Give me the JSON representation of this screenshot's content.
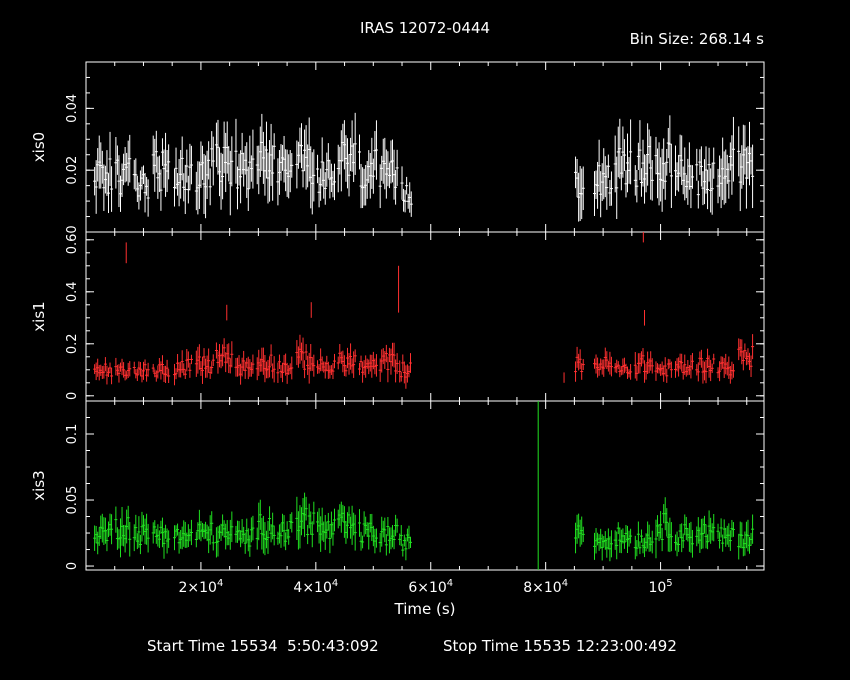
{
  "title": "IRAS 12072-0444",
  "bin_size_text": "Bin Size: 268.14 s",
  "xlabel": "Time (s)",
  "footer": {
    "start": "Start Time 15534  5:50:43:092",
    "stop": "Stop Time 15535 12:23:00:492"
  },
  "x_ticks": [
    {
      "value": 20000,
      "label": "2×10",
      "exp": "4"
    },
    {
      "value": 40000,
      "label": "4×10",
      "exp": "4"
    },
    {
      "value": 60000,
      "label": "6×10",
      "exp": "4"
    },
    {
      "value": 80000,
      "label": "8×10",
      "exp": "4"
    },
    {
      "value": 100000,
      "label": "10",
      "exp": "5"
    }
  ],
  "chart_data": [
    {
      "type": "line",
      "name": "xis0",
      "ylabel": "xis0",
      "color": "#ffffff",
      "ylim": [
        0,
        0.055
      ],
      "yticks": [
        {
          "v": 0.02,
          "l": "0.02"
        },
        {
          "v": 0.04,
          "l": "0.04"
        }
      ],
      "segments": [
        {
          "start": 1500,
          "end": 4600,
          "mean": 0.018,
          "amp": 0.006
        },
        {
          "start": 5200,
          "end": 7800,
          "mean": 0.018,
          "amp": 0.006
        },
        {
          "start": 8400,
          "end": 11000,
          "mean": 0.015,
          "amp": 0.005
        },
        {
          "start": 11700,
          "end": 14600,
          "mean": 0.02,
          "amp": 0.007
        },
        {
          "start": 15400,
          "end": 18600,
          "mean": 0.018,
          "amp": 0.006
        },
        {
          "start": 19200,
          "end": 22200,
          "mean": 0.02,
          "amp": 0.007
        },
        {
          "start": 22700,
          "end": 25500,
          "mean": 0.022,
          "amp": 0.007
        },
        {
          "start": 26100,
          "end": 29200,
          "mean": 0.02,
          "amp": 0.007
        },
        {
          "start": 29800,
          "end": 33000,
          "mean": 0.022,
          "amp": 0.007
        },
        {
          "start": 33400,
          "end": 36000,
          "mean": 0.02,
          "amp": 0.006
        },
        {
          "start": 36700,
          "end": 39800,
          "mean": 0.022,
          "amp": 0.007
        },
        {
          "start": 40300,
          "end": 43400,
          "mean": 0.018,
          "amp": 0.006
        },
        {
          "start": 43900,
          "end": 47000,
          "mean": 0.023,
          "amp": 0.007
        },
        {
          "start": 47600,
          "end": 50600,
          "mean": 0.02,
          "amp": 0.007
        },
        {
          "start": 51200,
          "end": 54300,
          "mean": 0.017,
          "amp": 0.006
        },
        {
          "start": 55000,
          "end": 56700,
          "mean": 0.012,
          "amp": 0.004
        },
        {
          "start": 85200,
          "end": 86800,
          "mean": 0.017,
          "amp": 0.006
        },
        {
          "start": 88500,
          "end": 91500,
          "mean": 0.018,
          "amp": 0.006
        },
        {
          "start": 92100,
          "end": 95000,
          "mean": 0.02,
          "amp": 0.007
        },
        {
          "start": 95600,
          "end": 98600,
          "mean": 0.021,
          "amp": 0.007
        },
        {
          "start": 99200,
          "end": 102000,
          "mean": 0.022,
          "amp": 0.007
        },
        {
          "start": 102600,
          "end": 105700,
          "mean": 0.02,
          "amp": 0.006
        },
        {
          "start": 106300,
          "end": 109400,
          "mean": 0.018,
          "amp": 0.006
        },
        {
          "start": 110000,
          "end": 112900,
          "mean": 0.021,
          "amp": 0.007
        },
        {
          "start": 113600,
          "end": 116200,
          "mean": 0.02,
          "amp": 0.007
        }
      ]
    },
    {
      "type": "line",
      "name": "xis1",
      "ylabel": "xis1",
      "color": "#ff3030",
      "ylim": [
        -0.02,
        0.63
      ],
      "yticks": [
        {
          "v": 0,
          "l": "0"
        },
        {
          "v": 0.2,
          "l": "0.2"
        },
        {
          "v": 0.4,
          "l": "0.4"
        },
        {
          "v": 0.6,
          "l": "0.60"
        }
      ],
      "segments": [
        {
          "start": 1500,
          "end": 4600,
          "mean": 0.1,
          "amp": 0.025
        },
        {
          "start": 5200,
          "end": 7800,
          "mean": 0.09,
          "amp": 0.025
        },
        {
          "start": 8400,
          "end": 11000,
          "mean": 0.1,
          "amp": 0.025
        },
        {
          "start": 11700,
          "end": 14600,
          "mean": 0.1,
          "amp": 0.025
        },
        {
          "start": 15400,
          "end": 18600,
          "mean": 0.11,
          "amp": 0.03
        },
        {
          "start": 19200,
          "end": 22200,
          "mean": 0.12,
          "amp": 0.035
        },
        {
          "start": 22700,
          "end": 25500,
          "mean": 0.15,
          "amp": 0.04
        },
        {
          "start": 26100,
          "end": 29200,
          "mean": 0.11,
          "amp": 0.03
        },
        {
          "start": 29800,
          "end": 33000,
          "mean": 0.13,
          "amp": 0.035
        },
        {
          "start": 33400,
          "end": 36000,
          "mean": 0.11,
          "amp": 0.03
        },
        {
          "start": 36700,
          "end": 39800,
          "mean": 0.14,
          "amp": 0.04
        },
        {
          "start": 40300,
          "end": 43400,
          "mean": 0.11,
          "amp": 0.03
        },
        {
          "start": 43900,
          "end": 47000,
          "mean": 0.13,
          "amp": 0.035
        },
        {
          "start": 47600,
          "end": 50600,
          "mean": 0.11,
          "amp": 0.03
        },
        {
          "start": 51200,
          "end": 54300,
          "mean": 0.13,
          "amp": 0.035
        },
        {
          "start": 54600,
          "end": 56700,
          "mean": 0.1,
          "amp": 0.03
        },
        {
          "start": 85200,
          "end": 86800,
          "mean": 0.12,
          "amp": 0.03
        },
        {
          "start": 88500,
          "end": 91500,
          "mean": 0.12,
          "amp": 0.03
        },
        {
          "start": 92100,
          "end": 95000,
          "mean": 0.1,
          "amp": 0.025
        },
        {
          "start": 95600,
          "end": 98600,
          "mean": 0.12,
          "amp": 0.035
        },
        {
          "start": 99200,
          "end": 102000,
          "mean": 0.1,
          "amp": 0.025
        },
        {
          "start": 102600,
          "end": 105700,
          "mean": 0.11,
          "amp": 0.03
        },
        {
          "start": 106300,
          "end": 109400,
          "mean": 0.12,
          "amp": 0.03
        },
        {
          "start": 110000,
          "end": 112900,
          "mean": 0.11,
          "amp": 0.03
        },
        {
          "start": 113600,
          "end": 116200,
          "mean": 0.15,
          "amp": 0.04
        }
      ],
      "outliers": [
        {
          "x": 7000,
          "y": 0.55,
          "err": 0.04
        },
        {
          "x": 54400,
          "y": 0.41,
          "err": 0.09
        },
        {
          "x": 83200,
          "y": 0.07,
          "err": 0.02
        },
        {
          "x": 97000,
          "y": 0.62,
          "err": 0.03
        },
        {
          "x": 97200,
          "y": 0.3,
          "err": 0.03
        },
        {
          "x": 24500,
          "y": 0.32,
          "err": 0.03
        },
        {
          "x": 39200,
          "y": 0.33,
          "err": 0.03
        }
      ]
    },
    {
      "type": "line",
      "name": "xis3",
      "ylabel": "xis3",
      "color": "#20e020",
      "ylim": [
        -0.003,
        0.125
      ],
      "yticks": [
        {
          "v": 0,
          "l": "0"
        },
        {
          "v": 0.05,
          "l": "0.05"
        },
        {
          "v": 0.1,
          "l": "0.1"
        }
      ],
      "segments": [
        {
          "start": 1500,
          "end": 4600,
          "mean": 0.025,
          "amp": 0.008
        },
        {
          "start": 5200,
          "end": 7800,
          "mean": 0.03,
          "amp": 0.01
        },
        {
          "start": 8400,
          "end": 11000,
          "mean": 0.024,
          "amp": 0.008
        },
        {
          "start": 11700,
          "end": 14600,
          "mean": 0.025,
          "amp": 0.008
        },
        {
          "start": 15400,
          "end": 18600,
          "mean": 0.022,
          "amp": 0.007
        },
        {
          "start": 19200,
          "end": 22200,
          "mean": 0.025,
          "amp": 0.008
        },
        {
          "start": 22700,
          "end": 25500,
          "mean": 0.024,
          "amp": 0.008
        },
        {
          "start": 26100,
          "end": 29200,
          "mean": 0.022,
          "amp": 0.007
        },
        {
          "start": 29800,
          "end": 33000,
          "mean": 0.03,
          "amp": 0.01
        },
        {
          "start": 33400,
          "end": 36000,
          "mean": 0.026,
          "amp": 0.008
        },
        {
          "start": 36700,
          "end": 39800,
          "mean": 0.035,
          "amp": 0.012
        },
        {
          "start": 40300,
          "end": 43400,
          "mean": 0.027,
          "amp": 0.009
        },
        {
          "start": 43900,
          "end": 47000,
          "mean": 0.03,
          "amp": 0.01
        },
        {
          "start": 47600,
          "end": 50600,
          "mean": 0.025,
          "amp": 0.008
        },
        {
          "start": 51200,
          "end": 54300,
          "mean": 0.023,
          "amp": 0.008
        },
        {
          "start": 54600,
          "end": 56700,
          "mean": 0.018,
          "amp": 0.006
        },
        {
          "start": 85200,
          "end": 86800,
          "mean": 0.028,
          "amp": 0.009
        },
        {
          "start": 88500,
          "end": 91500,
          "mean": 0.02,
          "amp": 0.007
        },
        {
          "start": 92100,
          "end": 95000,
          "mean": 0.022,
          "amp": 0.007
        },
        {
          "start": 95600,
          "end": 98600,
          "mean": 0.02,
          "amp": 0.007
        },
        {
          "start": 99200,
          "end": 102000,
          "mean": 0.03,
          "amp": 0.01
        },
        {
          "start": 102600,
          "end": 105700,
          "mean": 0.024,
          "amp": 0.008
        },
        {
          "start": 106300,
          "end": 109400,
          "mean": 0.025,
          "amp": 0.008
        },
        {
          "start": 110000,
          "end": 112900,
          "mean": 0.022,
          "amp": 0.007
        },
        {
          "start": 113600,
          "end": 116200,
          "mean": 0.022,
          "amp": 0.008
        }
      ],
      "outliers": [
        {
          "x": 78700,
          "y": 0.06,
          "err": 0.065
        }
      ]
    }
  ]
}
